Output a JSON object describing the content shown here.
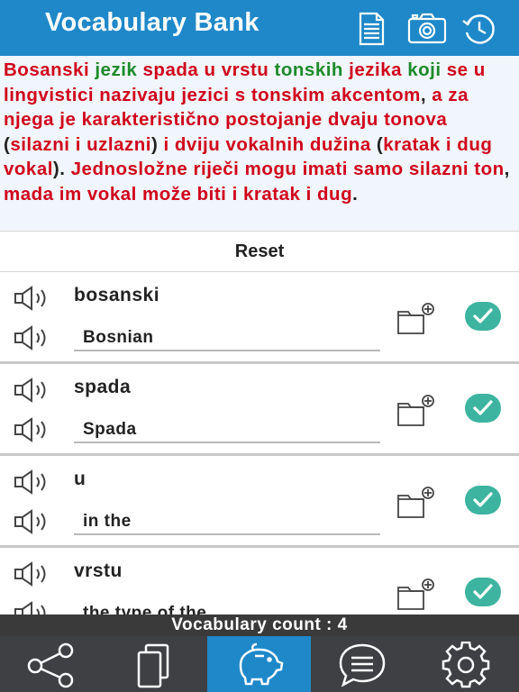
{
  "header": {
    "title": "Vocabulary Bank",
    "icons": [
      "document-icon",
      "camera-icon",
      "history-icon"
    ],
    "background": "#1e88c9"
  },
  "paragraph": {
    "tokens": [
      {
        "t": "Bosanski",
        "c": "red"
      },
      {
        "t": " "
      },
      {
        "t": "jezik",
        "c": "green"
      },
      {
        "t": " "
      },
      {
        "t": "spada",
        "c": "red"
      },
      {
        "t": " "
      },
      {
        "t": "u",
        "c": "red"
      },
      {
        "t": " "
      },
      {
        "t": "vrstu",
        "c": "red"
      },
      {
        "t": " "
      },
      {
        "t": "tonskih",
        "c": "green"
      },
      {
        "t": " "
      },
      {
        "t": "jezika",
        "c": "red"
      },
      {
        "t": " "
      },
      {
        "t": "koji",
        "c": "green"
      },
      {
        "t": " "
      },
      {
        "t": "se",
        "c": "red"
      },
      {
        "t": " "
      },
      {
        "t": "u",
        "c": "red"
      },
      {
        "t": " "
      },
      {
        "t": "lingvistici",
        "c": "red"
      },
      {
        "t": " "
      },
      {
        "t": "nazivaju",
        "c": "red"
      },
      {
        "t": " "
      },
      {
        "t": "jezici",
        "c": "red"
      },
      {
        "t": " "
      },
      {
        "t": "s",
        "c": "red"
      },
      {
        "t": " "
      },
      {
        "t": "tonskim",
        "c": "red"
      },
      {
        "t": " "
      },
      {
        "t": "akcentom",
        "c": "red"
      },
      {
        "t": ", ",
        "c": "punct"
      },
      {
        "t": "a",
        "c": "red"
      },
      {
        "t": " "
      },
      {
        "t": "za",
        "c": "red"
      },
      {
        "t": " "
      },
      {
        "t": "njega",
        "c": "red"
      },
      {
        "t": " "
      },
      {
        "t": "je",
        "c": "red"
      },
      {
        "t": " "
      },
      {
        "t": "karakteristično",
        "c": "red"
      },
      {
        "t": " "
      },
      {
        "t": "postojanje",
        "c": "red"
      },
      {
        "t": " "
      },
      {
        "t": "dvaju",
        "c": "red"
      },
      {
        "t": " "
      },
      {
        "t": "tonova",
        "c": "red"
      },
      {
        "t": " (",
        "c": "punct"
      },
      {
        "t": "silazni",
        "c": "red"
      },
      {
        "t": " "
      },
      {
        "t": "i",
        "c": "red"
      },
      {
        "t": " "
      },
      {
        "t": "uzlazni",
        "c": "red"
      },
      {
        "t": ") ",
        "c": "punct"
      },
      {
        "t": "i",
        "c": "red"
      },
      {
        "t": " "
      },
      {
        "t": "dviju",
        "c": "red"
      },
      {
        "t": " "
      },
      {
        "t": "vokalnih",
        "c": "red"
      },
      {
        "t": " "
      },
      {
        "t": "dužina",
        "c": "red"
      },
      {
        "t": " (",
        "c": "punct"
      },
      {
        "t": "kratak",
        "c": "red"
      },
      {
        "t": " "
      },
      {
        "t": "i",
        "c": "red"
      },
      {
        "t": " "
      },
      {
        "t": "dug",
        "c": "red"
      },
      {
        "t": " "
      },
      {
        "t": "vokal",
        "c": "red"
      },
      {
        "t": "). ",
        "c": "punct"
      },
      {
        "t": "Jednosložne",
        "c": "red"
      },
      {
        "t": " "
      },
      {
        "t": "riječi",
        "c": "red"
      },
      {
        "t": " "
      },
      {
        "t": "mogu",
        "c": "red"
      },
      {
        "t": " "
      },
      {
        "t": "imati",
        "c": "red"
      },
      {
        "t": " "
      },
      {
        "t": "samo",
        "c": "red"
      },
      {
        "t": " "
      },
      {
        "t": "silazni",
        "c": "red"
      },
      {
        "t": " "
      },
      {
        "t": "ton",
        "c": "red"
      },
      {
        "t": ", ",
        "c": "punct"
      },
      {
        "t": "mada",
        "c": "red"
      },
      {
        "t": " "
      },
      {
        "t": "im",
        "c": "red"
      },
      {
        "t": " "
      },
      {
        "t": "vokal",
        "c": "red"
      },
      {
        "t": " "
      },
      {
        "t": "može",
        "c": "red"
      },
      {
        "t": " "
      },
      {
        "t": "biti",
        "c": "red"
      },
      {
        "t": " "
      },
      {
        "t": "i",
        "c": "red"
      },
      {
        "t": " "
      },
      {
        "t": "kratak",
        "c": "red"
      },
      {
        "t": " "
      },
      {
        "t": "i",
        "c": "red"
      },
      {
        "t": " "
      },
      {
        "t": "dug",
        "c": "red"
      },
      {
        "t": ".",
        "c": "punct"
      }
    ],
    "colors": {
      "red": "#d0021b",
      "green": "#1d8a2a"
    }
  },
  "reset": {
    "label": "Reset"
  },
  "vocab": [
    {
      "word": "bosanski",
      "meaning": "Bosnian"
    },
    {
      "word": "spada",
      "meaning": "Spada"
    },
    {
      "word": "u",
      "meaning": "in the"
    },
    {
      "word": "vrstu",
      "meaning": "the type of the"
    }
  ],
  "count": {
    "label": "Vocabulary count : 4"
  },
  "tabs": [
    {
      "icon": "share-icon",
      "active": false
    },
    {
      "icon": "cards-icon",
      "active": false
    },
    {
      "icon": "piggy-bank-icon",
      "active": true
    },
    {
      "icon": "chat-icon",
      "active": false
    },
    {
      "icon": "settings-icon",
      "active": false
    }
  ],
  "accent": "#3cb4a0"
}
